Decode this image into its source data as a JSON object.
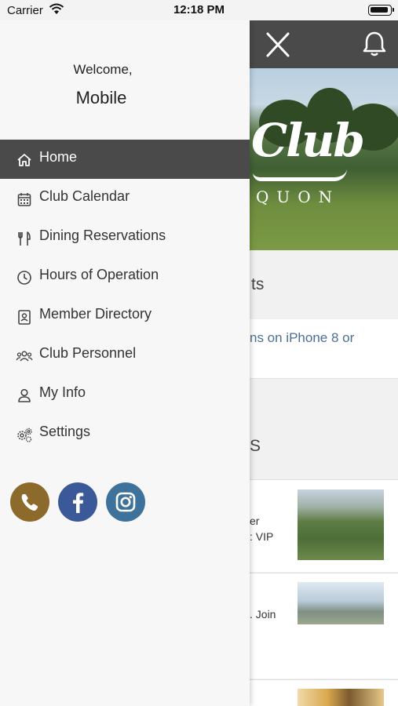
{
  "status_bar": {
    "carrier": "Carrier",
    "time": "12:18 PM",
    "battery_level": 0.9
  },
  "drawer": {
    "welcome": "Welcome,",
    "user_name": "Mobile",
    "menu": [
      {
        "label": "Home",
        "icon": "home-icon",
        "active": true
      },
      {
        "label": "Club Calendar",
        "icon": "calendar-icon",
        "active": false
      },
      {
        "label": "Dining Reservations",
        "icon": "utensils-icon",
        "active": false
      },
      {
        "label": "Hours of Operation",
        "icon": "clock-icon",
        "active": false
      },
      {
        "label": "Member Directory",
        "icon": "directory-icon",
        "active": false
      },
      {
        "label": "Club Personnel",
        "icon": "people-icon",
        "active": false
      },
      {
        "label": "My Info",
        "icon": "user-icon",
        "active": false
      },
      {
        "label": "Settings",
        "icon": "gears-icon",
        "active": false
      }
    ],
    "social": [
      {
        "name": "phone-icon",
        "color": "#8c6a2c"
      },
      {
        "name": "facebook-icon",
        "color": "#3b5998"
      },
      {
        "name": "instagram-icon",
        "color": "#3f729b"
      }
    ]
  },
  "background": {
    "header_color": "#4a4a4a",
    "hero": {
      "script_text": "Club",
      "subtitle": "QUON"
    },
    "section1_title": "ts",
    "card1_text": "ns on iPhone 8 or",
    "section2_title": "S",
    "news": [
      {
        "text_line1": "er",
        "text_line2": ": VIP"
      },
      {
        "text_line1": ". Join",
        "text_line2": ""
      },
      {
        "text_line1": "",
        "text_line2": ""
      }
    ]
  }
}
